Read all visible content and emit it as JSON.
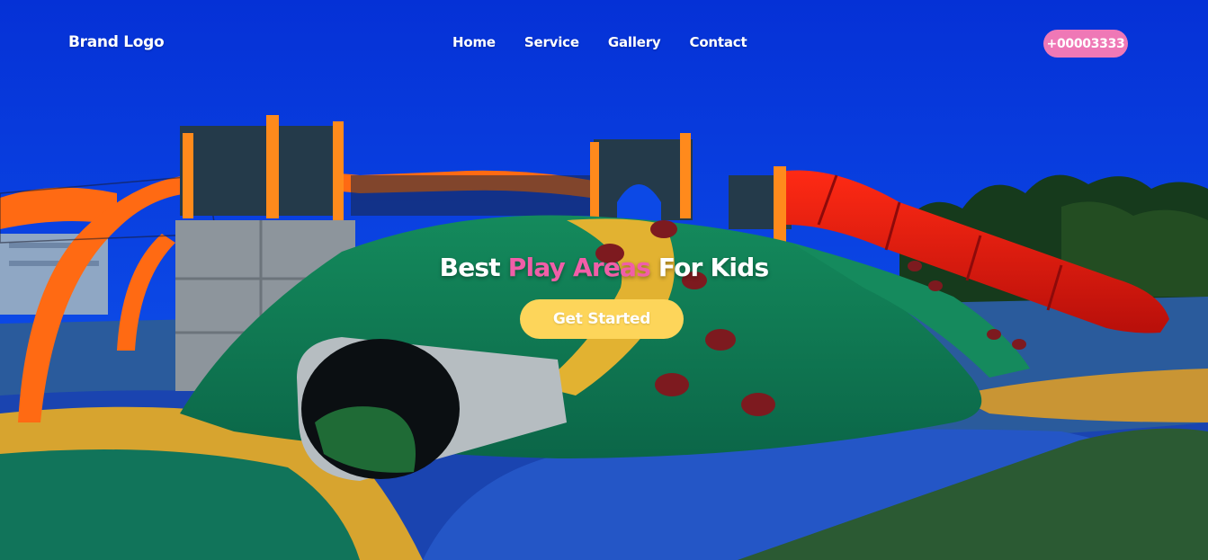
{
  "brand": {
    "logo_text": "Brand Logo"
  },
  "nav": {
    "items": [
      {
        "label": "Home"
      },
      {
        "label": "Service"
      },
      {
        "label": "Gallery"
      },
      {
        "label": "Contact"
      }
    ],
    "phone": "+00003333"
  },
  "hero": {
    "headline_part1": "Best ",
    "headline_accent": "Play Areas",
    "headline_part2": " For Kids",
    "cta_label": "Get Started"
  },
  "colors": {
    "sky": "#0a3ad8",
    "accent_pink": "#f15ea8",
    "phone_pill": "#ef78b6",
    "cta_yellow": "#fdd55a",
    "nav_text": "#ffffff"
  }
}
